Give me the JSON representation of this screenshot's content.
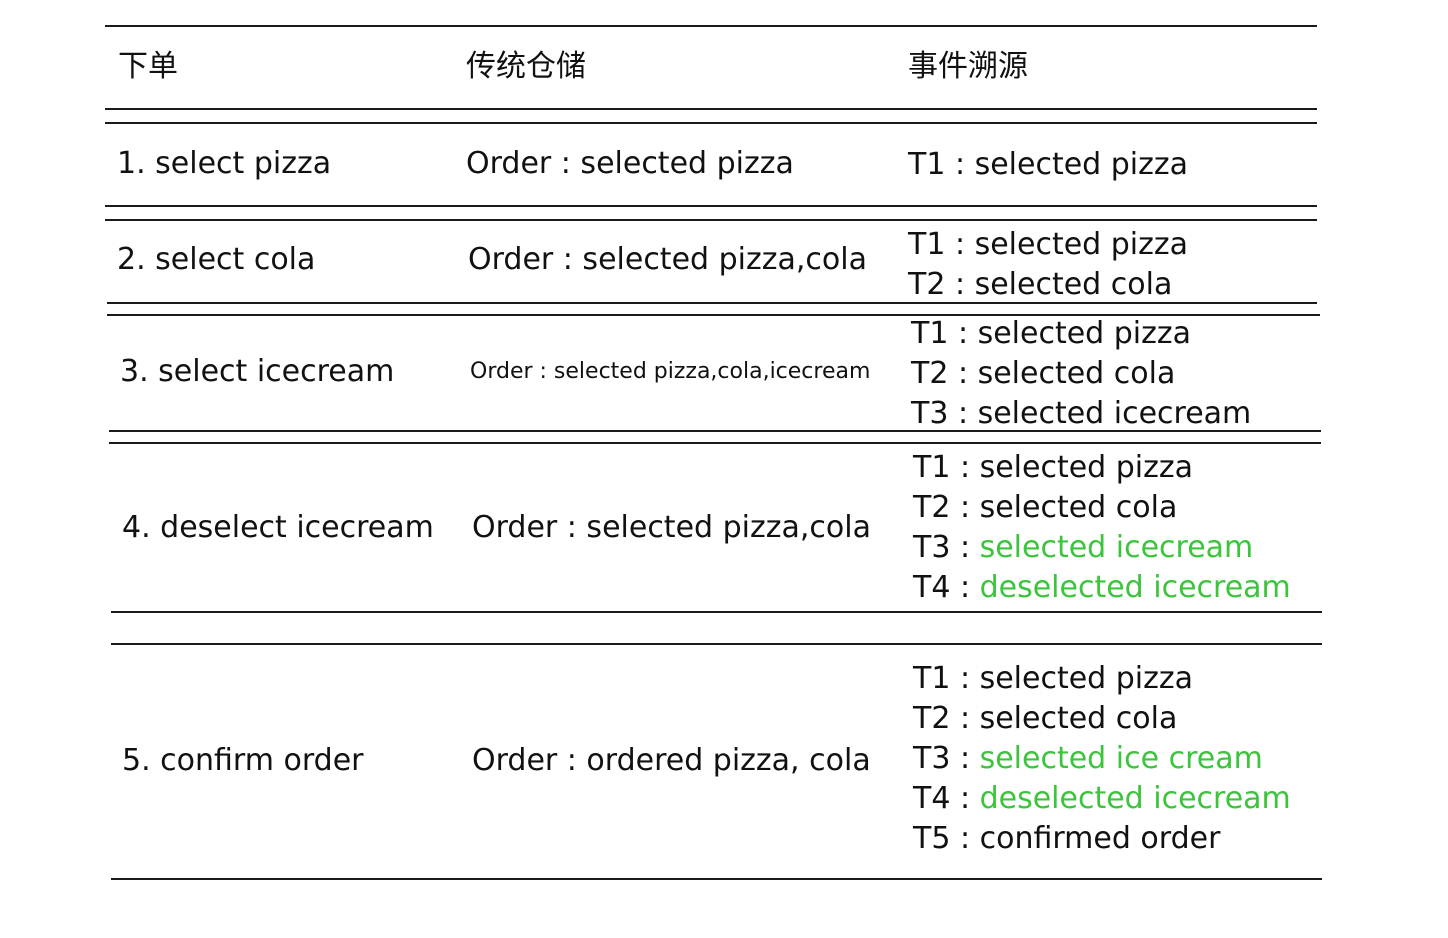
{
  "highlight_color": "#3cc43c",
  "table": {
    "headers": [
      "下单",
      "传统仓储",
      "事件溯源"
    ],
    "rows": [
      {
        "action": "1. select pizza",
        "traditional": "Order : selected pizza",
        "events": [
          {
            "label": "T1 : ",
            "text": "selected pizza",
            "highlight": false
          }
        ]
      },
      {
        "action": "2. select cola",
        "traditional": "Order : selected pizza,cola",
        "events": [
          {
            "label": "T1 : ",
            "text": "selected pizza",
            "highlight": false
          },
          {
            "label": "T2 : ",
            "text": "selected cola",
            "highlight": false
          }
        ]
      },
      {
        "action": "3. select icecream",
        "traditional": "Order : selected pizza,cola,icecream",
        "events": [
          {
            "label": "T1 : ",
            "text": "selected pizza",
            "highlight": false
          },
          {
            "label": "T2 : ",
            "text": "selected cola",
            "highlight": false
          },
          {
            "label": "T3 : ",
            "text": "selected icecream",
            "highlight": false
          }
        ]
      },
      {
        "action": "4. deselect icecream",
        "traditional": "Order : selected pizza,cola",
        "events": [
          {
            "label": "T1 : ",
            "text": "selected pizza",
            "highlight": false
          },
          {
            "label": "T2 : ",
            "text": "selected cola",
            "highlight": false
          },
          {
            "label": "T3 : ",
            "text": "selected icecream",
            "highlight": true
          },
          {
            "label": "T4 : ",
            "text": "deselected icecream",
            "highlight": true
          }
        ]
      },
      {
        "action": "5. confirm order",
        "traditional": "Order : ordered pizza, cola",
        "events": [
          {
            "label": "T1 : ",
            "text": "selected pizza",
            "highlight": false
          },
          {
            "label": "T2 : ",
            "text": "selected cola",
            "highlight": false
          },
          {
            "label": "T3 : ",
            "text": "selected ice cream",
            "highlight": true
          },
          {
            "label": "T4 : ",
            "text": "deselected icecream",
            "highlight": true
          },
          {
            "label": "T5 : ",
            "text": "confirmed order",
            "highlight": false
          }
        ]
      }
    ]
  }
}
